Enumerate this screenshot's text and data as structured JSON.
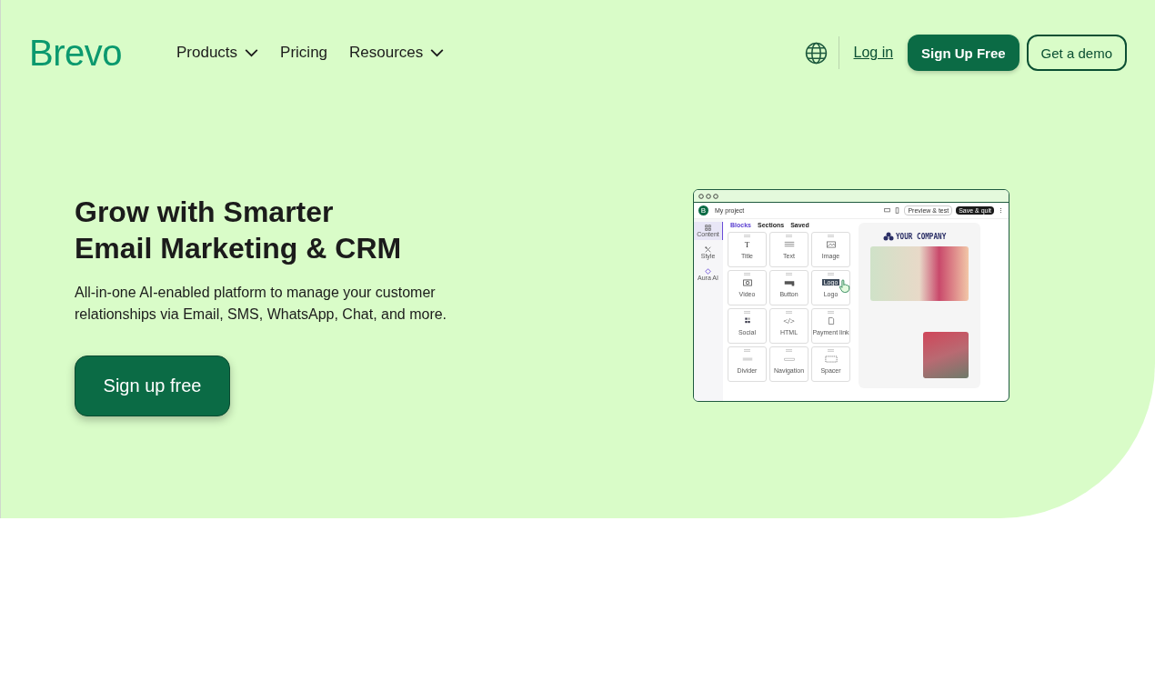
{
  "nav": {
    "logo": "Brevo",
    "links": [
      {
        "label": "Products",
        "dropdown": true
      },
      {
        "label": "Pricing",
        "dropdown": false
      },
      {
        "label": "Resources",
        "dropdown": true
      }
    ],
    "login": "Log in",
    "signup": "Sign Up Free",
    "demo": "Get a demo"
  },
  "hero": {
    "title_lines": [
      "Grow with Smarter",
      "Email Marketing & CRM"
    ],
    "description": "All-in-one AI-enabled platform to manage your customer relationships via Email, SMS, WhatsApp, Chat, and more.",
    "cta": "Sign up free"
  },
  "editor": {
    "logo_letter": "B",
    "project": "My project",
    "toolbar_buttons": [
      {
        "label": "Preview & test",
        "kind": "outline"
      },
      {
        "label": "Save & quit",
        "kind": "solid"
      }
    ],
    "side_items": [
      {
        "label": "Content",
        "kind": "grid",
        "selected": true
      },
      {
        "label": "Style",
        "kind": "brush",
        "selected": false
      },
      {
        "label": "Aura AI",
        "kind": "sparkle",
        "selected": false
      }
    ],
    "tabs": [
      {
        "label": "Blocks",
        "selected": true
      },
      {
        "label": "Sections",
        "selected": false
      },
      {
        "label": "Saved",
        "selected": false
      }
    ],
    "blocks": [
      {
        "label": "Title",
        "kind": "glyph",
        "glyph": "T",
        "cursor": false
      },
      {
        "label": "Text",
        "kind": "lines",
        "cursor": false
      },
      {
        "label": "Image",
        "kind": "image",
        "cursor": false
      },
      {
        "label": "Video",
        "kind": "video",
        "cursor": false
      },
      {
        "label": "Button",
        "kind": "button",
        "cursor": false
      },
      {
        "label": "Logo",
        "kind": "badge",
        "glyph": "Logo",
        "cursor": true
      },
      {
        "label": "Social",
        "kind": "social",
        "cursor": false
      },
      {
        "label": "HTML",
        "kind": "glyph",
        "glyph": "</>",
        "cursor": false
      },
      {
        "label": "Payment link",
        "kind": "file",
        "cursor": false
      },
      {
        "label": "Divider",
        "kind": "divider",
        "cursor": false
      },
      {
        "label": "Navigation",
        "kind": "nav",
        "cursor": false
      },
      {
        "label": "Spacer",
        "kind": "spacer",
        "cursor": false
      }
    ],
    "preview": {
      "company": "YOUR COMPANY"
    }
  }
}
